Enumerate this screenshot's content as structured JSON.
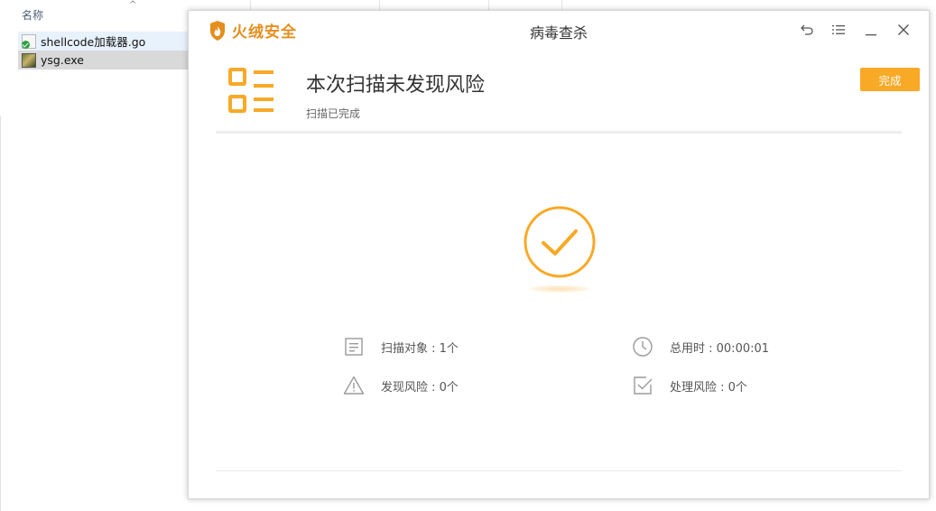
{
  "explorer": {
    "column_name": "名称",
    "files": [
      {
        "name": "shellcode加载器.go",
        "icon": "go-file-icon"
      },
      {
        "name": "ysg.exe",
        "icon": "exe-file-icon"
      }
    ]
  },
  "dialog": {
    "brand": "火绒安全",
    "window_title": "病毒查杀",
    "headline": "本次扫描未发现风险",
    "subline": "扫描已完成",
    "done_button": "完成",
    "stats": {
      "scanned_objects": "扫描对象 : 1个",
      "total_time": "总用时 : 00:00:01",
      "risks_found": "发现风险 : 0个",
      "risks_handled": "处理风险 : 0个"
    }
  },
  "colors": {
    "accent": "#f8a926",
    "brand": "#e58e1e",
    "icon_gray": "#9a9a9a"
  },
  "icons": [
    "undo-icon",
    "menu-icon",
    "minimize-icon",
    "close-icon",
    "report-list-icon",
    "success-check-icon",
    "document-icon",
    "clock-icon",
    "warning-icon",
    "checkbox-icon"
  ]
}
